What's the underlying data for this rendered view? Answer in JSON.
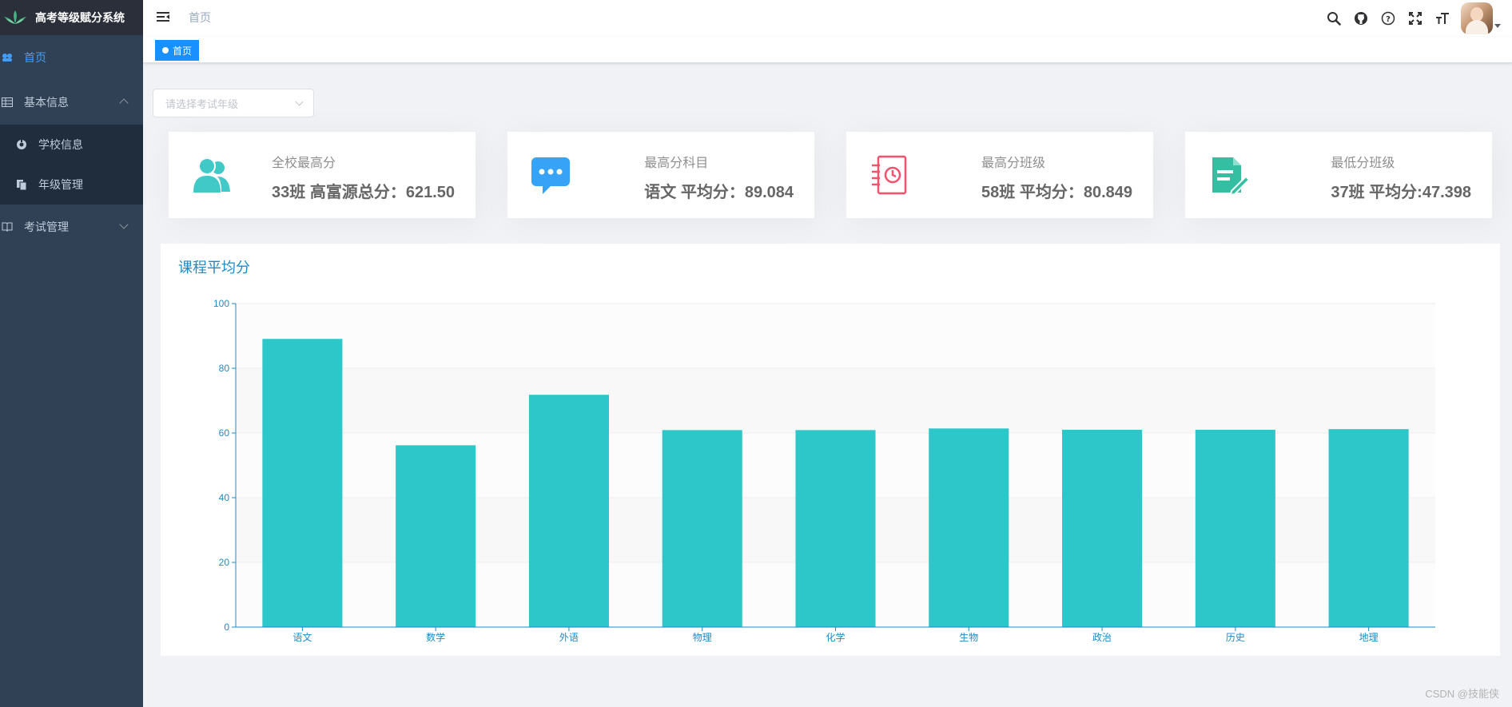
{
  "app": {
    "title": "高考等级赋分系统"
  },
  "sidebar": {
    "items": [
      {
        "label": "首页",
        "icon": "dashboard-icon",
        "active": true
      },
      {
        "label": "基本信息",
        "icon": "table-icon",
        "expanded": true,
        "children": [
          {
            "label": "学校信息",
            "icon": "settings-icon"
          },
          {
            "label": "年级管理",
            "icon": "copy-icon"
          }
        ]
      },
      {
        "label": "考试管理",
        "icon": "book-icon",
        "expanded": false
      }
    ]
  },
  "navbar": {
    "breadcrumb": "首页",
    "icons": [
      "search-icon",
      "github-icon",
      "question-icon",
      "fullscreen-icon",
      "font-size-icon"
    ]
  },
  "tags": [
    {
      "label": "首页",
      "active": true
    }
  ],
  "filter": {
    "placeholder": "请选择考试年级"
  },
  "cards": [
    {
      "label": "全校最高分",
      "value": "33班 高富源总分：621.50",
      "icon": "peoples-icon",
      "color": "#40c9c6"
    },
    {
      "label": "最高分科目",
      "value": "语文 平均分：89.084",
      "icon": "message-icon",
      "color": "#36a3f7"
    },
    {
      "label": "最高分班级",
      "value": "58班 平均分：80.849",
      "icon": "clock-note-icon",
      "color": "#f4516c"
    },
    {
      "label": "最低分班级",
      "value": "37班 平均分:47.398",
      "icon": "edit-doc-icon",
      "color": "#34bfa3"
    }
  ],
  "chart": {
    "title": "课程平均分"
  },
  "chart_data": {
    "type": "bar",
    "categories": [
      "语文",
      "数学",
      "外语",
      "物理",
      "化学",
      "生物",
      "政治",
      "历史",
      "地理"
    ],
    "values": [
      89.08,
      56.2,
      71.8,
      60.9,
      60.9,
      61.4,
      61.0,
      61.0,
      61.2
    ],
    "ylim": [
      0,
      100
    ],
    "yticks": [
      0,
      20,
      40,
      60,
      80,
      100
    ],
    "bar_color": "#2ec7c9",
    "axis_color": "#1f8ac4",
    "grid": true,
    "xlabel": "",
    "ylabel": ""
  },
  "watermark": "CSDN @技能侠"
}
